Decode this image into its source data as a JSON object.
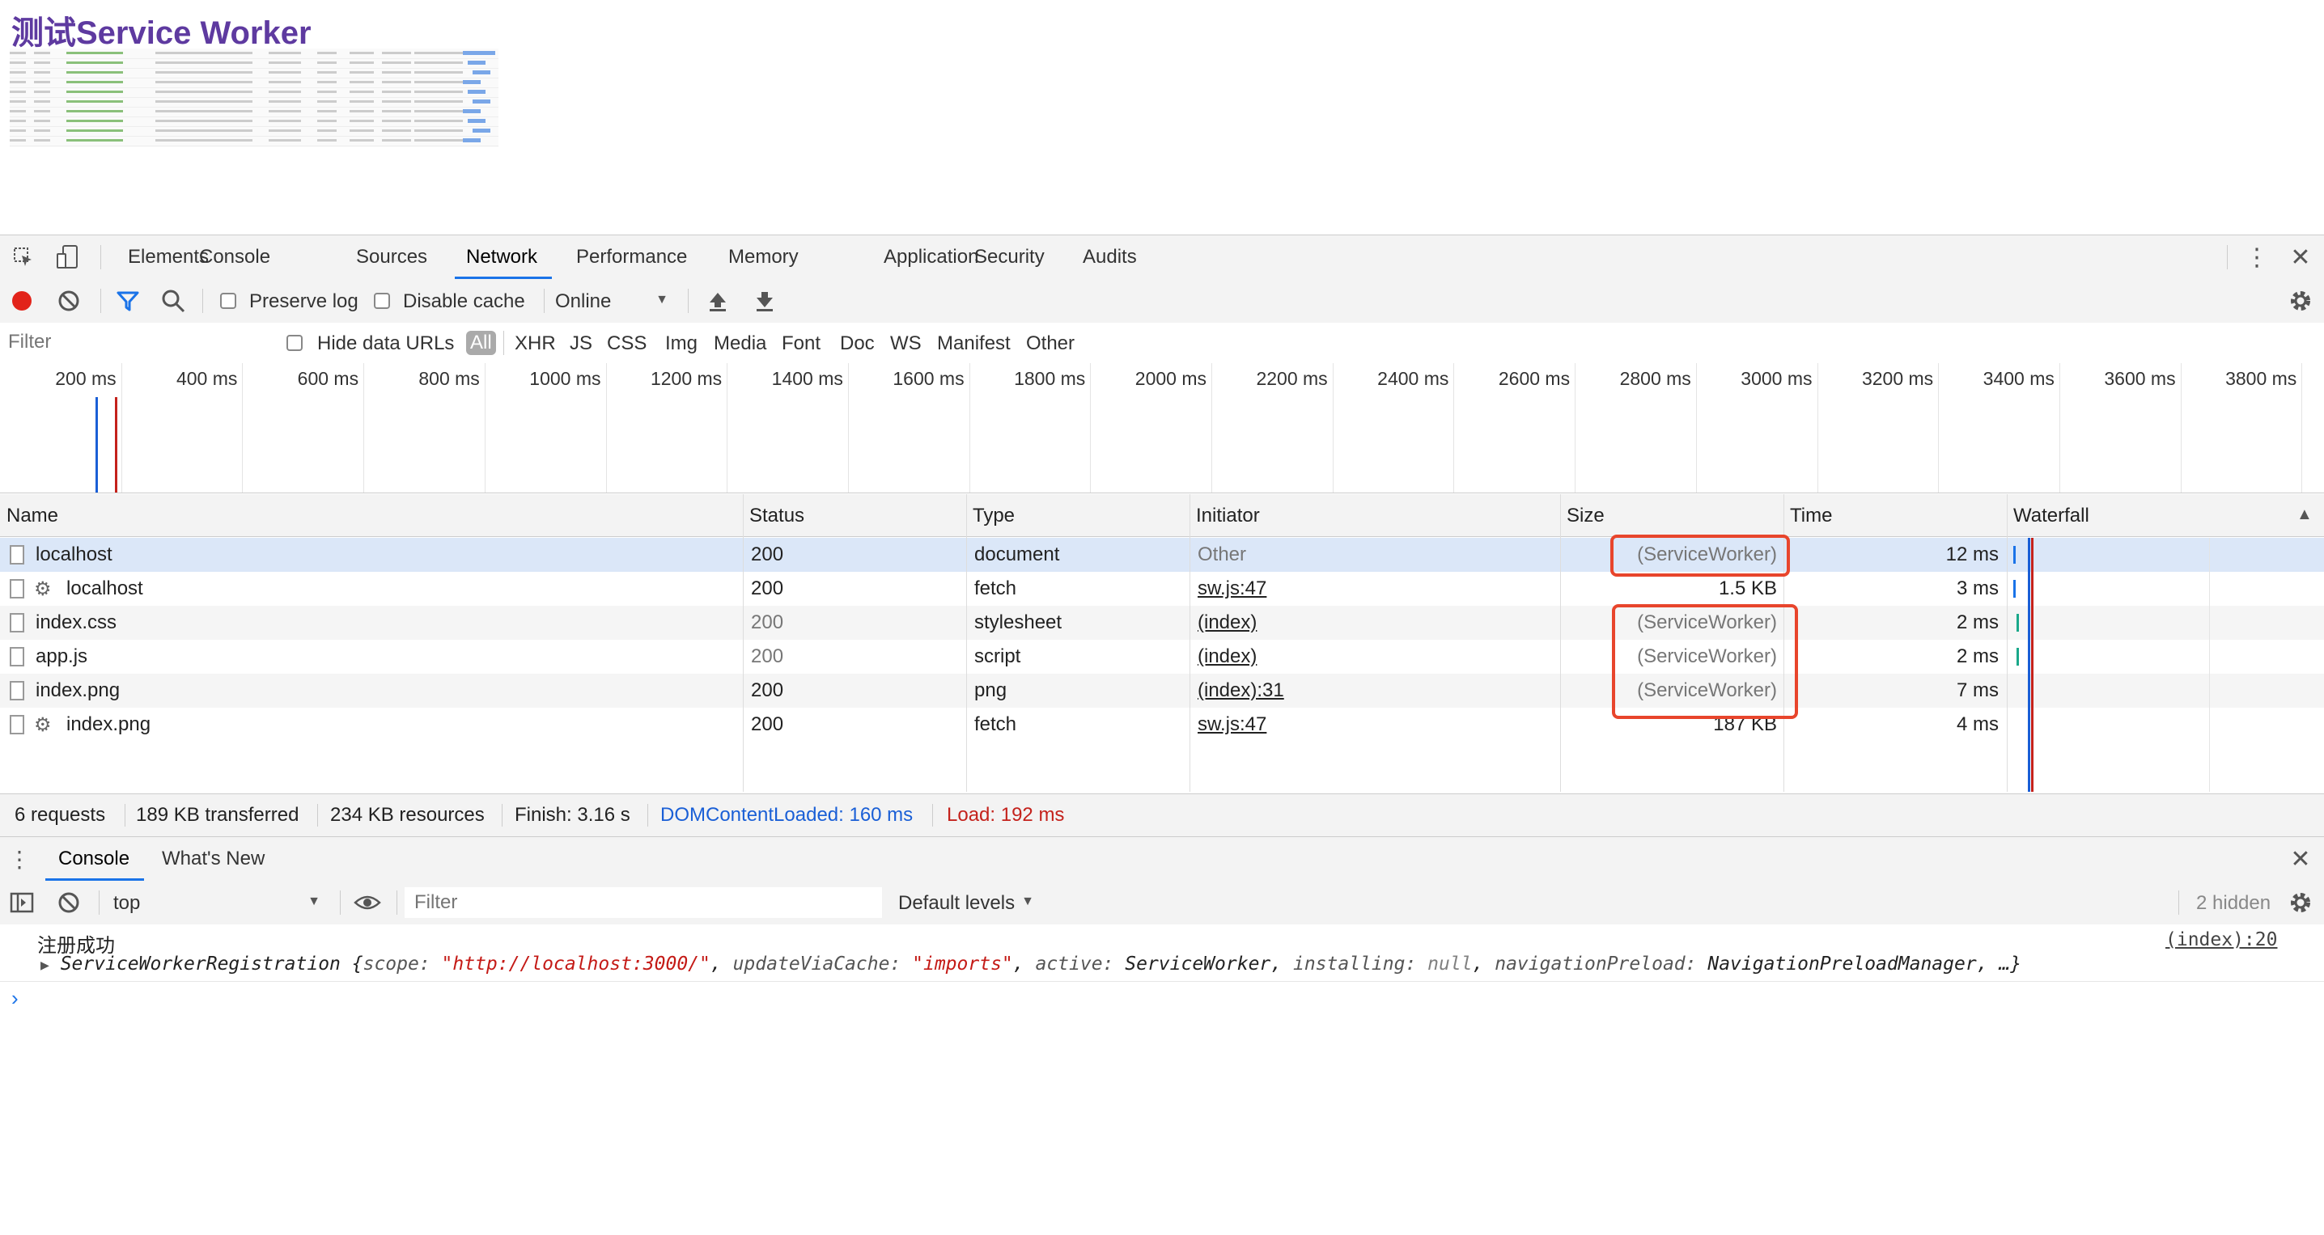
{
  "page": {
    "title": "测试Service Worker"
  },
  "devtools": {
    "tabs": [
      "Elements",
      "Console",
      "Sources",
      "Network",
      "Performance",
      "Memory",
      "Application",
      "Security",
      "Audits"
    ],
    "active_tab": "Network"
  },
  "network_toolbar": {
    "preserve_log": "Preserve log",
    "disable_cache": "Disable cache",
    "throttle": "Online"
  },
  "filter_bar": {
    "placeholder": "Filter",
    "hide_data_urls": "Hide data URLs",
    "types": [
      "All",
      "XHR",
      "JS",
      "CSS",
      "Img",
      "Media",
      "Font",
      "Doc",
      "WS",
      "Manifest",
      "Other"
    ],
    "active_type": "All"
  },
  "timeline": {
    "ticks": [
      "200 ms",
      "400 ms",
      "600 ms",
      "800 ms",
      "1000 ms",
      "1200 ms",
      "1400 ms",
      "1600 ms",
      "1800 ms",
      "2000 ms",
      "2200 ms",
      "2400 ms",
      "2600 ms",
      "2800 ms",
      "3000 ms",
      "3200 ms",
      "3400 ms",
      "3600 ms",
      "3800 ms"
    ],
    "dom_content_loaded_ms": 160,
    "load_ms": 192
  },
  "table": {
    "headers": {
      "name": "Name",
      "status": "Status",
      "type": "Type",
      "initiator": "Initiator",
      "size": "Size",
      "time": "Time",
      "waterfall": "Waterfall"
    },
    "rows": [
      {
        "name": "localhost",
        "status": "200",
        "type": "document",
        "initiator": "Other",
        "size": "(ServiceWorker)",
        "time": "12 ms",
        "sw_fetch": false
      },
      {
        "name": "localhost",
        "status": "200",
        "type": "fetch",
        "initiator": "sw.js:47",
        "size": "1.5 KB",
        "time": "3 ms",
        "sw_fetch": true
      },
      {
        "name": "index.css",
        "status": "200",
        "type": "stylesheet",
        "initiator": "(index)",
        "size": "(ServiceWorker)",
        "time": "2 ms",
        "sw_fetch": false
      },
      {
        "name": "app.js",
        "status": "200",
        "type": "script",
        "initiator": "(index)",
        "size": "(ServiceWorker)",
        "time": "2 ms",
        "sw_fetch": false
      },
      {
        "name": "index.png",
        "status": "200",
        "type": "png",
        "initiator": "(index):31",
        "size": "(ServiceWorker)",
        "time": "7 ms",
        "sw_fetch": false
      },
      {
        "name": "index.png",
        "status": "200",
        "type": "fetch",
        "initiator": "sw.js:47",
        "size": "187 KB",
        "time": "4 ms",
        "sw_fetch": true
      }
    ]
  },
  "summary": {
    "requests": "6 requests",
    "transferred": "189 KB transferred",
    "resources": "234 KB resources",
    "finish": "Finish: 3.16 s",
    "dcl": "DOMContentLoaded: 160 ms",
    "load": "Load: 192 ms"
  },
  "drawer": {
    "tabs": [
      "Console",
      "What's New"
    ],
    "active_tab": "Console",
    "context": "top",
    "filter_placeholder": "Filter",
    "levels": "Default levels",
    "hidden": "2 hidden"
  },
  "console": {
    "line1_text": "注册成功",
    "line1_source": "(index):20",
    "obj": {
      "type": "ServiceWorkerRegistration",
      "scope_key": "scope: ",
      "scope_val": "\"http://localhost:3000/\"",
      "uvc_key": "updateViaCache: ",
      "uvc_val": "\"imports\"",
      "active_key": "active: ",
      "active_val": "ServiceWorker",
      "installing_key": "installing: ",
      "installing_val": "null",
      "nav_key": "navigationPreload: ",
      "nav_val": "NavigationPreloadManager",
      "tail": ", …}"
    }
  },
  "colors": {
    "accent": "#1a73e8",
    "highlight": "#e8452c",
    "dcl": "#1a5fd6",
    "load": "#c4221c",
    "title": "#5e3aa0"
  }
}
